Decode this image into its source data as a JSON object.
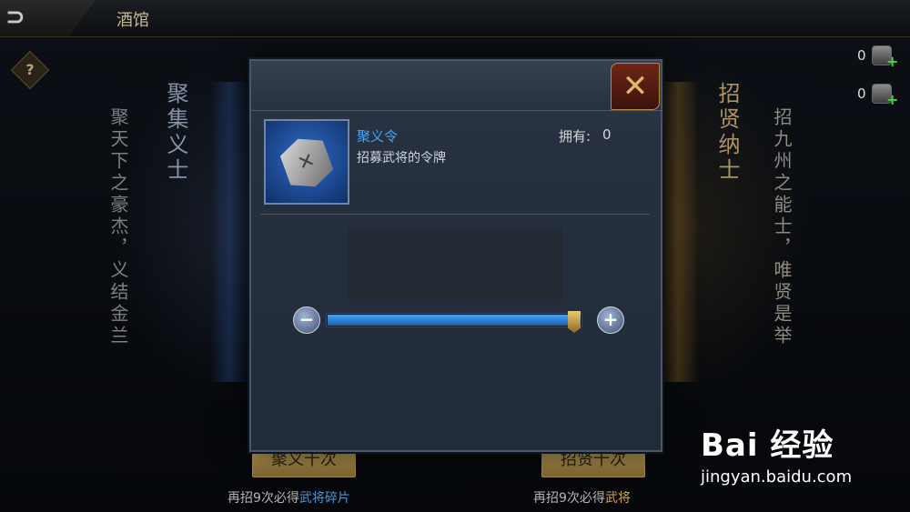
{
  "header": {
    "title": "酒馆"
  },
  "resources": [
    {
      "count": "0"
    },
    {
      "count": "0"
    }
  ],
  "left_panel": {
    "heading": "聚集义士",
    "motto": "聚天下之豪杰，义结金兰",
    "button_label": "聚义十次",
    "note_prefix": "再招9次必得",
    "note_highlight": "武将碎片"
  },
  "right_panel": {
    "heading": "招贤纳士",
    "motto": "招九州之能士，唯贤是举",
    "button_label": "招贤十次",
    "note_prefix": "再招9次必得",
    "note_highlight": "武将"
  },
  "modal": {
    "item_name": "聚义令",
    "item_description": "招募武将的令牌",
    "owned_label": "拥有:",
    "owned_value": "0",
    "slider": {
      "fraction": 0.99
    },
    "minus_label": "−",
    "plus_label": "+"
  },
  "watermark": {
    "logo": "Bai 经验",
    "url": "jingyan.baidu.com"
  },
  "colors": {
    "accent_blue": "#3f9ae6",
    "accent_gold": "#d9a441",
    "close_red": "#6e2618"
  },
  "icons": [
    "back-icon",
    "help-icon",
    "resource-icon",
    "close-icon",
    "token-icon",
    "minus-icon",
    "plus-icon"
  ]
}
